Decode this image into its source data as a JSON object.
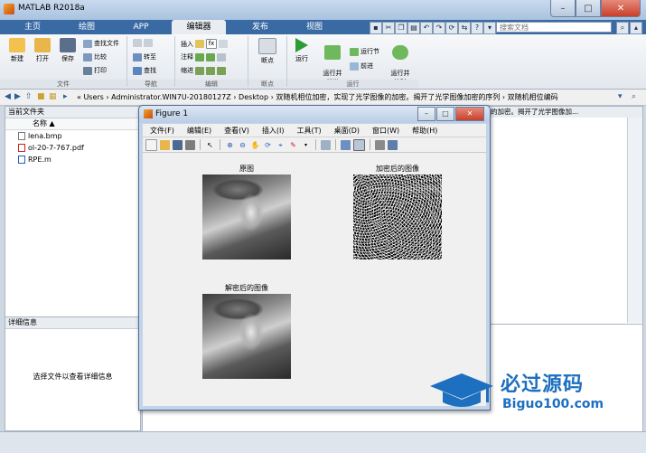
{
  "app": {
    "title": "MATLAB R2018a",
    "window_buttons": {
      "minimize": "–",
      "maximize": "□",
      "close": "✕"
    }
  },
  "tabs": [
    {
      "label": "主页"
    },
    {
      "label": "绘图"
    },
    {
      "label": "APP"
    },
    {
      "label": "编辑器"
    },
    {
      "label": "发布"
    },
    {
      "label": "视图"
    }
  ],
  "search": {
    "placeholder": "搜索文档"
  },
  "ribbon": {
    "file": {
      "new": "新建",
      "open": "打开",
      "save": "保存",
      "find_files": "查找文件",
      "compare": "比较",
      "print": "打印",
      "section": "文件"
    },
    "navigate": {
      "goto": "转至",
      "find": "查找",
      "section": "导航"
    },
    "edit": {
      "insert": "插入",
      "comment": "注释",
      "indent": "缩进",
      "section": "编辑"
    },
    "breakpoints": {
      "label": "断点",
      "section": "断点"
    },
    "run": {
      "run": "运行",
      "run_advance": "运行并\n前进",
      "run_section": "运行节",
      "advance": "前进",
      "run_time": "运行并\n计时",
      "section": "运行"
    }
  },
  "address": {
    "path": "« Users › Administrator.WIN7U-20180127Z › Desktop › 双随机相位加密，实现了光学图像的加密。揭开了光学图像加密的序列 › 双随机相位编码"
  },
  "current_folder": {
    "header": "当前文件夹",
    "col_name": "名称 ▲",
    "files": [
      {
        "name": "lena.bmp",
        "kind": "bmp"
      },
      {
        "name": "ol-20-7-767.pdf",
        "kind": "pdf"
      },
      {
        "name": "RPE.m",
        "kind": "m"
      }
    ]
  },
  "details": {
    "header": "详细信息",
    "message": "选择文件以查看详细信息"
  },
  "editor_tab_text": "的加密。揭开了光学图像加...",
  "figure": {
    "title": "Figure 1",
    "menu": [
      "文件(F)",
      "编辑(E)",
      "查看(V)",
      "插入(I)",
      "工具(T)",
      "桌面(D)",
      "窗口(W)",
      "帮助(H)"
    ],
    "axes": [
      {
        "title": "原图",
        "image": "lena-grayscale"
      },
      {
        "title": "加密后的图像",
        "image": "random-noise"
      },
      {
        "title": "解密后的图像",
        "image": "lena-grayscale"
      }
    ]
  },
  "watermark": {
    "line1": "必过源码",
    "line2": "Biguo100.com"
  }
}
